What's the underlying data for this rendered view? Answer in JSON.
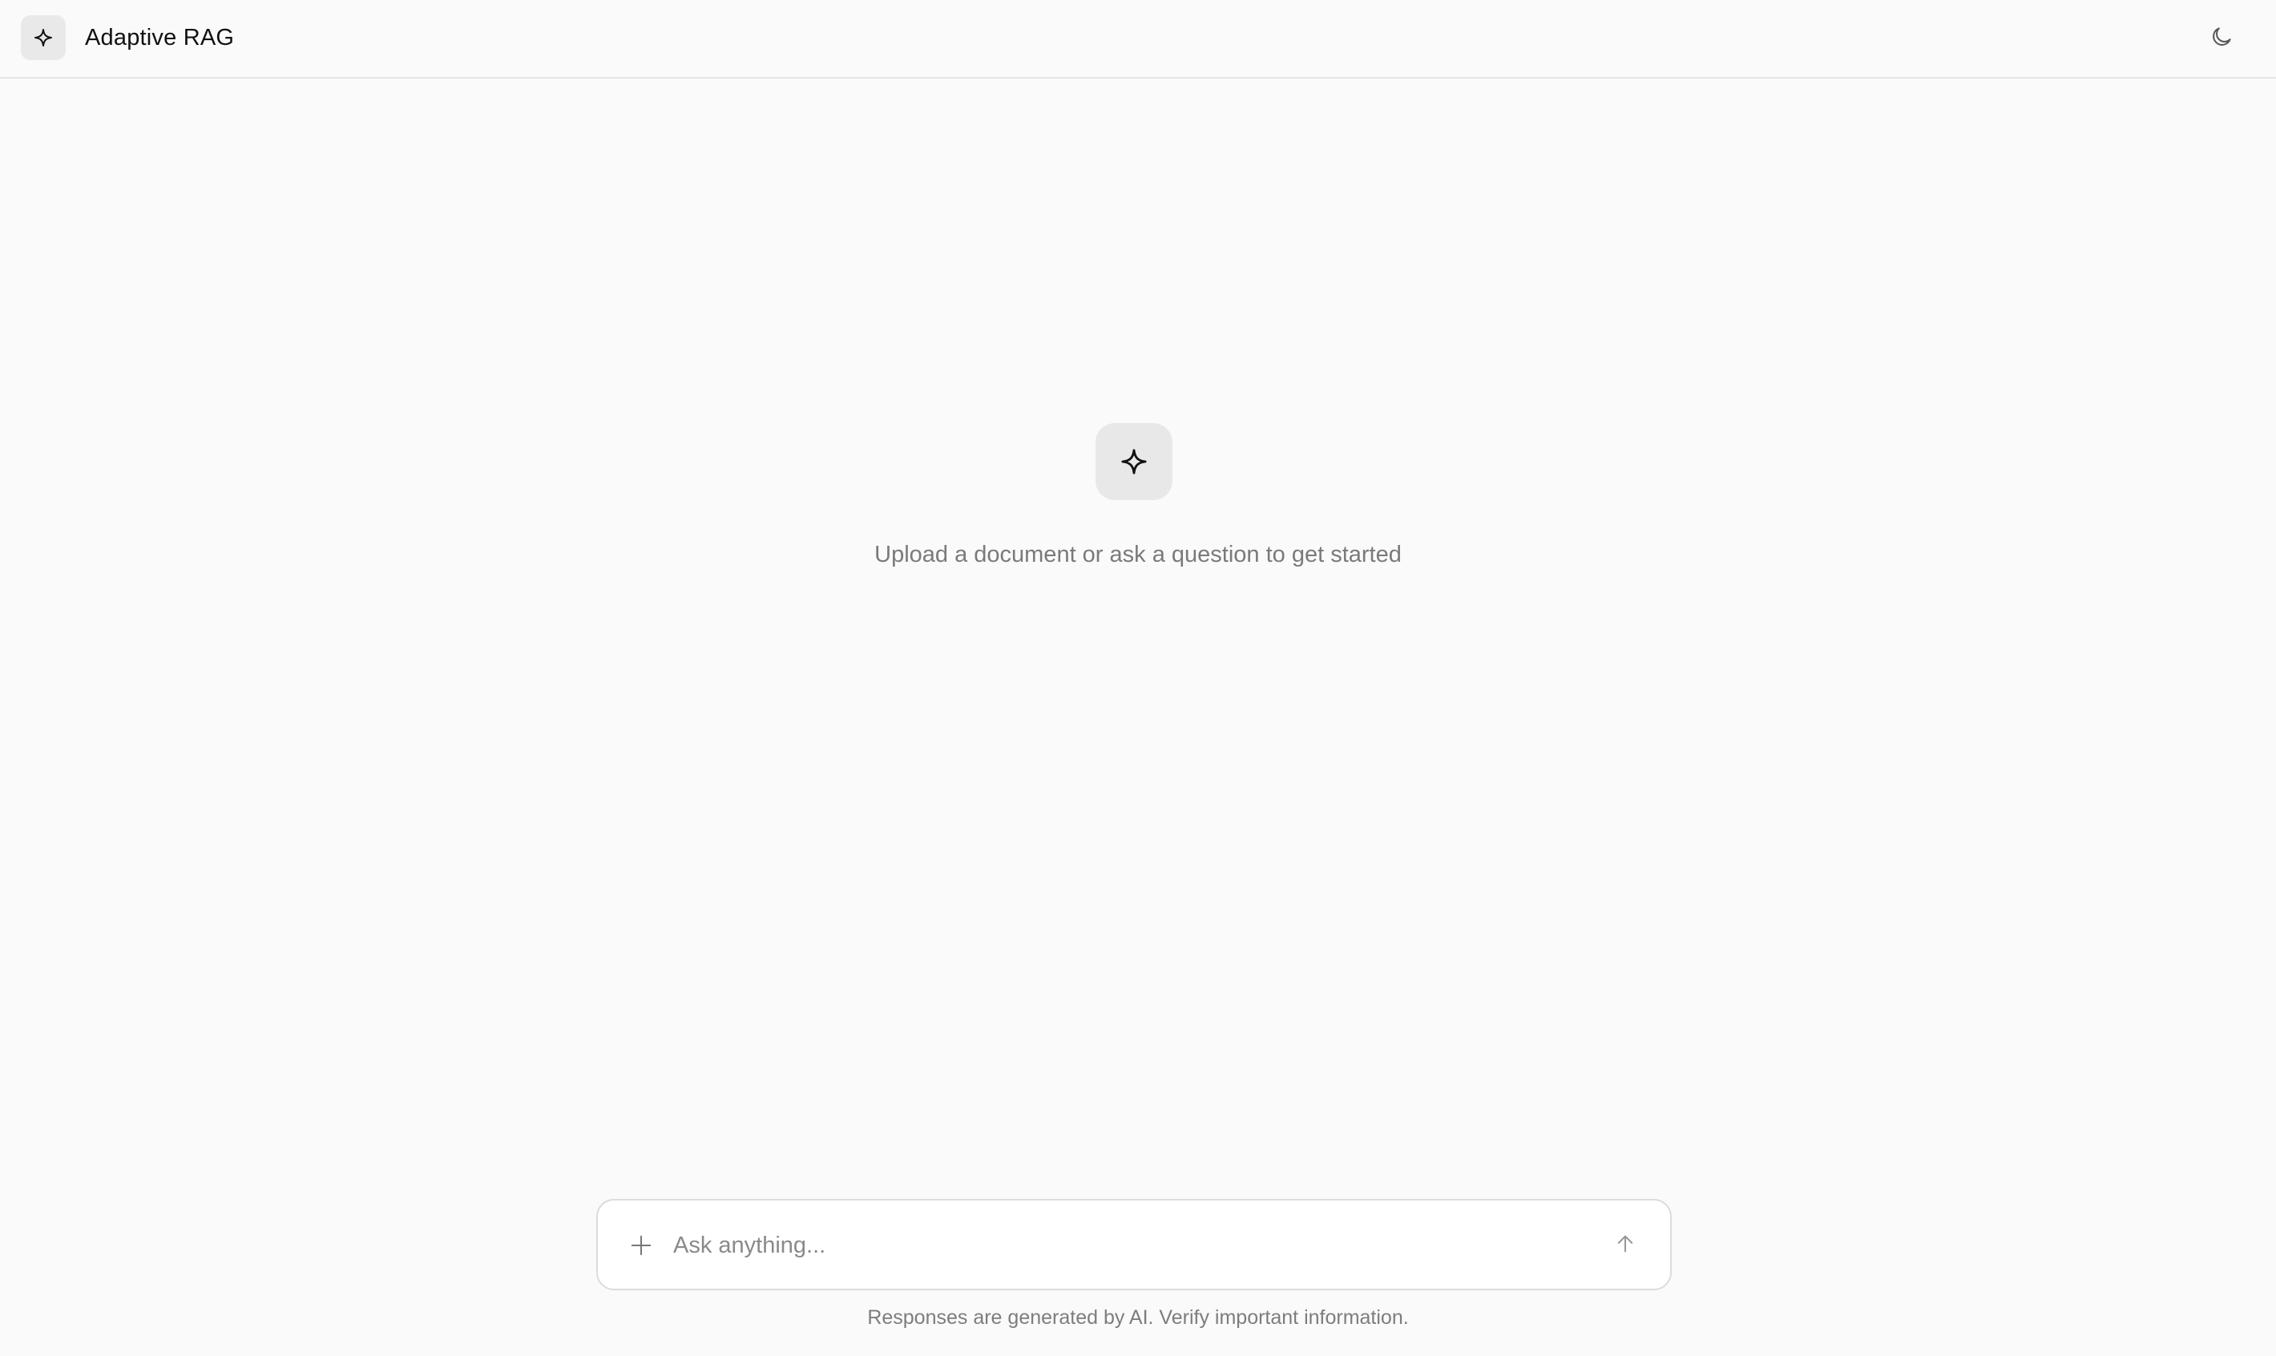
{
  "header": {
    "title": "Adaptive RAG",
    "logo_icon": "sparkle-icon",
    "theme_toggle_icon": "moon-icon"
  },
  "empty_state": {
    "icon": "sparkle-icon",
    "message": "Upload a document or ask a question to get started"
  },
  "composer": {
    "placeholder": "Ask anything...",
    "value": "",
    "attach_icon": "plus-icon",
    "send_icon": "arrow-up-icon"
  },
  "footer": {
    "disclaimer": "Responses are generated by AI. Verify important information."
  },
  "colors": {
    "background": "#fafafa",
    "icon_tile": "#e9e9e9",
    "muted_text": "#7a7a7a",
    "border": "#dcdcdc"
  }
}
